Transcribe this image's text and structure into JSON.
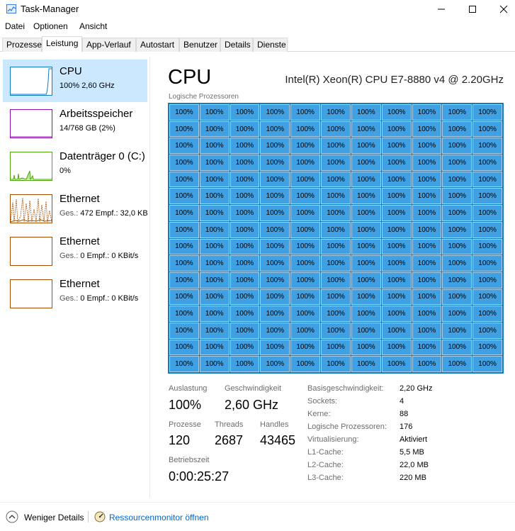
{
  "window": {
    "title": "Task-Manager",
    "icon": "task-manager-icon"
  },
  "menu": [
    "Datei",
    "Optionen",
    "Ansicht"
  ],
  "tabs": [
    {
      "label": "Prozesse",
      "active": false
    },
    {
      "label": "Leistung",
      "active": true
    },
    {
      "label": "App-Verlauf",
      "active": false
    },
    {
      "label": "Autostart",
      "active": false
    },
    {
      "label": "Benutzer",
      "active": false
    },
    {
      "label": "Details",
      "active": false
    },
    {
      "label": "Dienste",
      "active": false
    }
  ],
  "sidebar": {
    "items": [
      {
        "title": "CPU",
        "sub": "100%  2,60 GHz",
        "sub_muted": "",
        "color": "#117dbb",
        "selected": true
      },
      {
        "title": "Arbeitsspeicher",
        "sub": "14/768 GB (2%)",
        "sub_muted": "",
        "color": "#8b12ae",
        "selected": false
      },
      {
        "title": "Datenträger 0 (C:)",
        "sub": "0%",
        "sub_muted": "",
        "color": "#4da60c",
        "selected": false
      },
      {
        "title": "Ethernet",
        "sub_muted": "Ges.: ",
        "sub": "472  Empf.: 32,0 KB",
        "color": "#a74f01",
        "selected": false
      },
      {
        "title": "Ethernet",
        "sub_muted": "Ges.: ",
        "sub": "0  Empf.: 0 KBit/s",
        "color": "#a74f01",
        "selected": false
      },
      {
        "title": "Ethernet",
        "sub_muted": "Ges.: ",
        "sub": "0  Empf.: 0 KBit/s",
        "color": "#a74f01",
        "selected": false
      }
    ]
  },
  "main": {
    "title": "CPU",
    "cpu_model": "Intel(R) Xeon(R) CPU E7-8880 v4 @ 2.20GHz",
    "grid_label": "Logische Prozessoren",
    "cell_value": "100%",
    "cell_count": 176
  },
  "stats": {
    "auslastung_label": "Auslastung",
    "auslastung_value": "100%",
    "geschwindigkeit_label": "Geschwindigkeit",
    "geschwindigkeit_value": "2,60 GHz",
    "prozesse_label": "Prozesse",
    "prozesse_value": "120",
    "threads_label": "Threads",
    "threads_value": "2687",
    "handles_label": "Handles",
    "handles_value": "43465",
    "betriebszeit_label": "Betriebszeit",
    "betriebszeit_value": "0:00:25:27"
  },
  "info": [
    {
      "label": "Basisgeschwindigkeit:",
      "value": "2,20 GHz"
    },
    {
      "label": "Sockets:",
      "value": "4"
    },
    {
      "label": "Kerne:",
      "value": "88"
    },
    {
      "label": "Logische Prozessoren:",
      "value": "176"
    },
    {
      "label": "Virtualisierung:",
      "value": "Aktiviert"
    },
    {
      "label": "L1-Cache:",
      "value": "5,5 MB"
    },
    {
      "label": "L2-Cache:",
      "value": "22,0 MB"
    },
    {
      "label": "L3-Cache:",
      "value": "220 MB"
    }
  ],
  "footer": {
    "less_details": "Weniger Details",
    "resource_monitor": "Ressourcenmonitor öffnen"
  },
  "colors": {
    "cpu_blue": "#117dbb",
    "cell_fill": "#3fa0e4",
    "selected_bg": "#cce8ff",
    "link": "#0066cc"
  }
}
